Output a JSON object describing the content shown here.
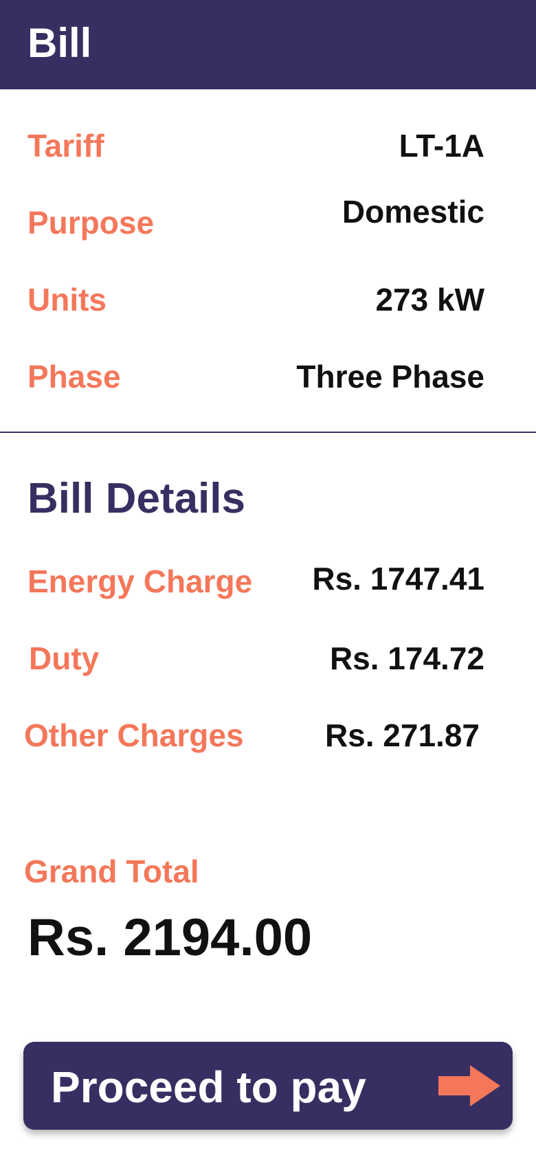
{
  "header": {
    "title": "Bill"
  },
  "info": {
    "tariff_label": "Tariff",
    "tariff_value": "LT-1A",
    "purpose_label": "Purpose",
    "purpose_value": "Domestic",
    "units_label": "Units",
    "units_value": "273 kW",
    "phase_label": "Phase",
    "phase_value": "Three Phase"
  },
  "bill_details": {
    "title": "Bill Details",
    "energy_label": "Energy Charge",
    "energy_value": "Rs. 1747.41",
    "duty_label": "Duty",
    "duty_value": "Rs. 174.72",
    "other_label": "Other Charges",
    "other_value": "Rs. 271.87"
  },
  "total": {
    "label": "Grand Total",
    "value": "Rs. 2194.00"
  },
  "pay_button": {
    "label": "Proceed to pay",
    "icon": "arrow-right-icon"
  },
  "colors": {
    "primary": "#372f61",
    "accent": "#f4775a",
    "text": "#111111",
    "background": "#ffffff"
  }
}
